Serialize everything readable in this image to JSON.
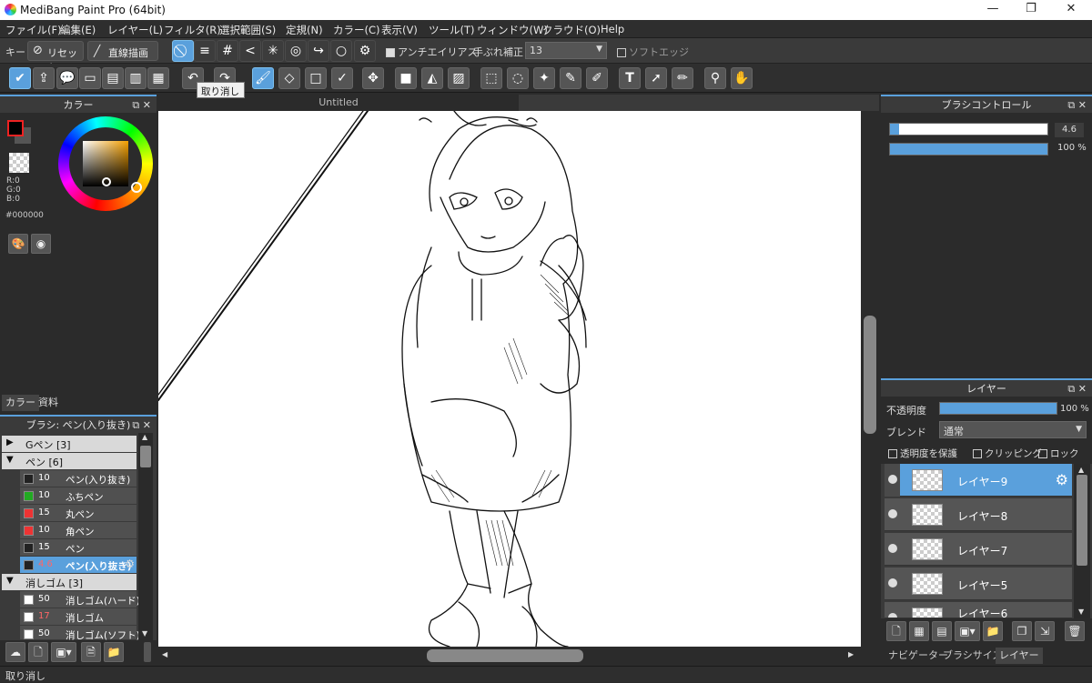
{
  "window": {
    "title": "MediBang Paint Pro (64bit)",
    "minimize": "—",
    "restore": "❐",
    "close": "✕"
  },
  "menu": [
    "ファイル(F)",
    "編集(E)",
    "レイヤー(L)",
    "フィルタ(R)",
    "選択範囲(S)",
    "定規(N)",
    "カラー(C)",
    "表示(V)",
    "ツール(T)",
    "ウィンドウ(W)",
    "クラウド(O)",
    "Help"
  ],
  "toolbar1": {
    "key_label": "キー",
    "reset_label": "リセット",
    "straight_label": "直線描画",
    "antialias_label": "アンチエイリアス",
    "stabilizer_label": "手ぶれ補正",
    "stabilizer_value": "13",
    "soft_edge_label": "ソフトエッジ"
  },
  "toolbar2": {
    "tooltip": "取り消し"
  },
  "canvas": {
    "tab_title": "Untitled"
  },
  "color_panel": {
    "title": "カラー",
    "r": "R:0",
    "g": "G:0",
    "b": "B:0",
    "hex": "#000000",
    "tab_color": "カラー",
    "tab_material": "資料",
    "fg": "#000000"
  },
  "brush_panel": {
    "title": "ブラシ: ペン(入り抜き)",
    "groups": [
      {
        "name": "Gペン [3]",
        "tri": "▶",
        "open": false,
        "items": []
      },
      {
        "name": "ペン [6]",
        "tri": "▼",
        "open": true,
        "items": [
          {
            "size": "10",
            "name": "ペン(入り抜き)",
            "color": "#222222"
          },
          {
            "size": "10",
            "name": "ふちペン",
            "color": "#22aa22"
          },
          {
            "size": "15",
            "name": "丸ペン",
            "color": "#ee3333"
          },
          {
            "size": "10",
            "name": "角ペン",
            "color": "#ee3333"
          },
          {
            "size": "15",
            "name": "ペン",
            "color": "#222222"
          },
          {
            "size": "4.6",
            "name": "ペン(入り抜き)",
            "color": "#222222",
            "selected": true
          }
        ]
      },
      {
        "name": "消しゴム [3]",
        "tri": "▼",
        "open": true,
        "items": [
          {
            "size": "50",
            "name": "消しゴム(ハード)",
            "color": "#ffffff"
          },
          {
            "size": "17",
            "name": "消しゴム",
            "color": "#ffffff"
          },
          {
            "size": "50",
            "name": "消しゴム(ソフト)",
            "color": "#ffffff"
          }
        ]
      }
    ]
  },
  "brush_control": {
    "title": "ブラシコントロール",
    "size_value": "4.6",
    "opacity_value": "100 %",
    "size_fraction": 0.06,
    "opacity_fraction": 1.0
  },
  "layer_panel": {
    "title": "レイヤー",
    "opacity_label": "不透明度",
    "opacity_value": "100 %",
    "blend_label": "ブレンド",
    "blend_value": "通常",
    "protect_alpha": "透明度を保護",
    "clipping": "クリッピング",
    "lock": "ロック",
    "opacity_fraction": 1.0,
    "layers": [
      {
        "name": "レイヤー9",
        "selected": true
      },
      {
        "name": "レイヤー8"
      },
      {
        "name": "レイヤー7"
      },
      {
        "name": "レイヤー5"
      },
      {
        "name": "レイヤー6"
      }
    ]
  },
  "bottom_tabs": [
    "ナビゲーター",
    "ブラシサイズ",
    "レイヤー"
  ],
  "statusbar": "取り消し"
}
